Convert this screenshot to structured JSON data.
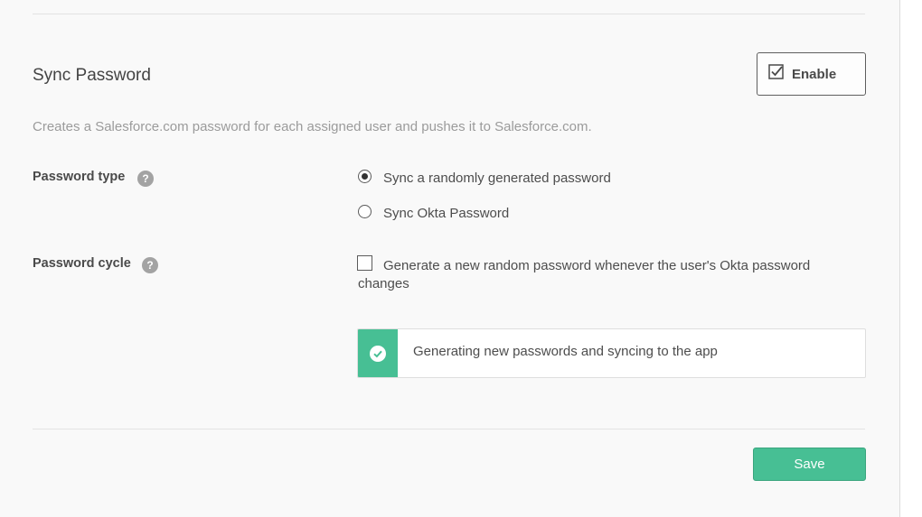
{
  "section": {
    "title": "Sync Password",
    "enable_label": "Enable",
    "description": "Creates a Salesforce.com password for each assigned user and pushes it to Salesforce.com."
  },
  "password_type": {
    "label": "Password type",
    "help": "?",
    "options": [
      {
        "label": "Sync a randomly generated password",
        "selected": true
      },
      {
        "label": "Sync Okta Password",
        "selected": false
      }
    ]
  },
  "password_cycle": {
    "label": "Password cycle",
    "help": "?",
    "checkbox_label": "Generate a new random password whenever the user's Okta password changes",
    "checked": false
  },
  "status": {
    "text": "Generating new passwords and syncing to the app",
    "color": "#47bf94"
  },
  "footer": {
    "save_label": "Save"
  }
}
